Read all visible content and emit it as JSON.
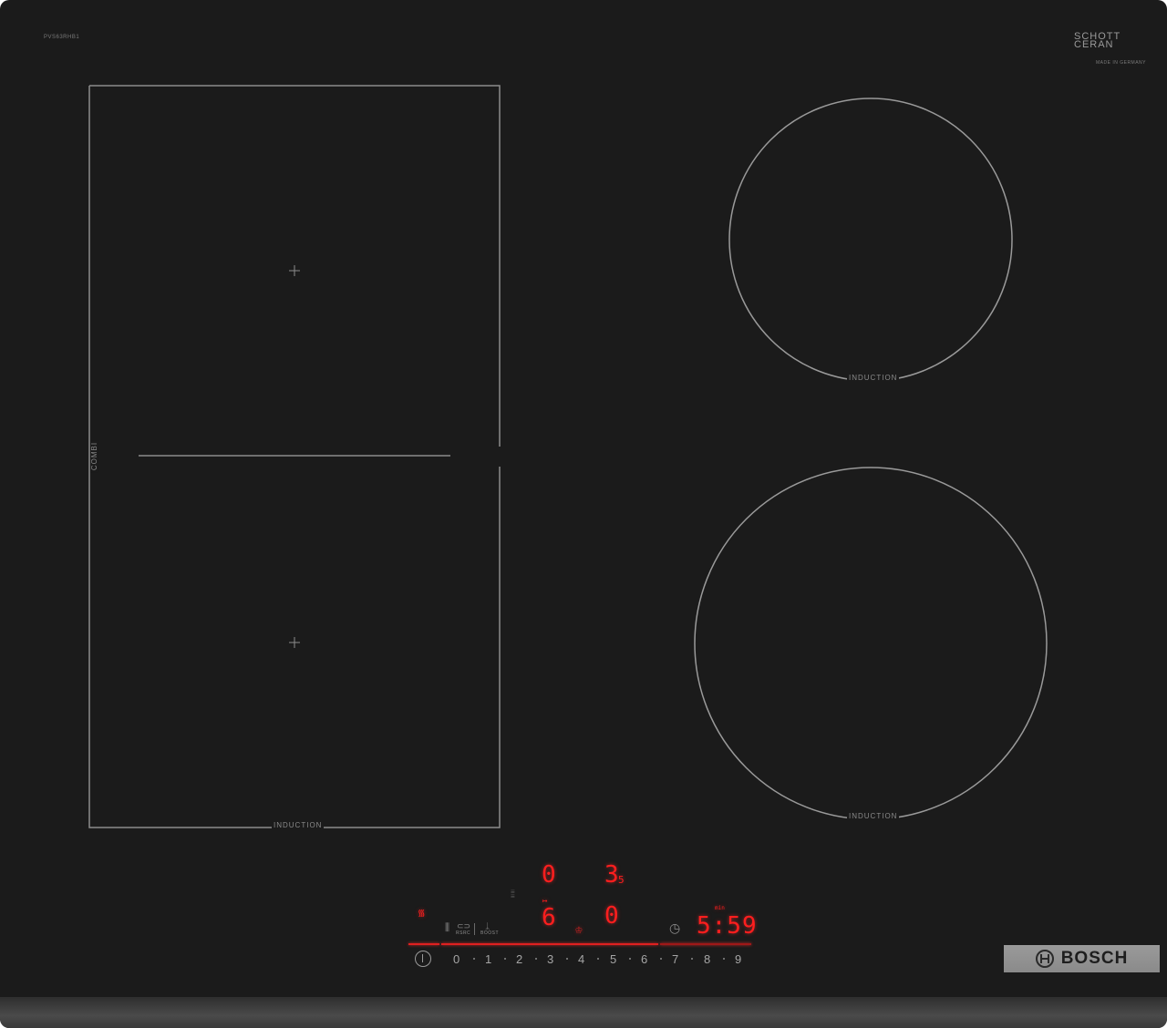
{
  "model": "PVS63RHB1",
  "schott_ceran": {
    "line1": "SCHOTT",
    "line2": "CERAN",
    "subtitle": "MADE IN GERMANY"
  },
  "zones": {
    "combi_label": "COMBI",
    "flex_label": "INDUCTION",
    "top_right_label": "INDUCTION",
    "bottom_right_label": "INDUCTION"
  },
  "display": {
    "top_left_digit": "0",
    "top_right_digit": "3",
    "top_right_subscript": "5",
    "bottom_left_digit": "6",
    "bottom_right_digit": "0",
    "timer_label": "min",
    "timer_value": "5:59"
  },
  "controls": {
    "wifi_icon": "wifi-icon",
    "pan_sensor_icon": "pan-sensor-icon",
    "pan_sensor_label": "RSRC",
    "boost_icon": "boost-icon",
    "boost_label": "BOOST",
    "timer_icon": "clock-icon",
    "power_icon": "power-icon",
    "chef_icon": "chef-hat-icon",
    "scale": [
      "0",
      "1",
      "2",
      "3",
      "4",
      "5",
      "6",
      "7",
      "8",
      "9"
    ]
  },
  "brand": "BOSCH",
  "colors": {
    "glass": "#1b1b1b",
    "display_red": "#ff1e1e",
    "frame": "#4a4a4a",
    "brand_plate": "#8f8f8f"
  }
}
